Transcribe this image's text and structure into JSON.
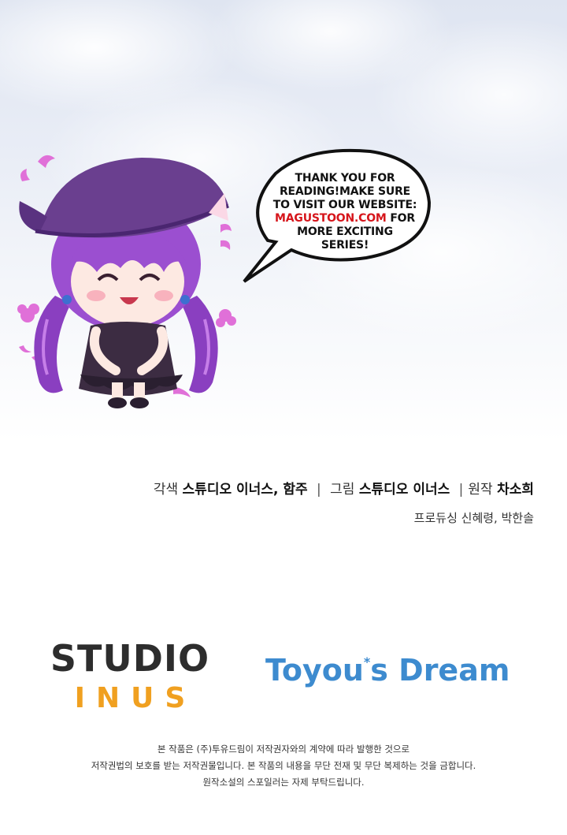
{
  "speech_bubble": {
    "line1": "THANK YOU FOR",
    "line2": "READING!MAKE SURE",
    "line3": "TO VISIT OUR WEBSITE:",
    "line4_link": "MAGUSTOON.COM",
    "line4_rest": " FOR",
    "line5": "MORE EXCITING",
    "line6": "SERIES!"
  },
  "credits": {
    "adaptation_label": "각색",
    "adaptation_value": "스튜디오 이너스, 함주",
    "art_label": "그림",
    "art_value": "스튜디오 이너스",
    "original_label": "원작",
    "original_value": "차소희",
    "separator": "|",
    "producing_label": "프로듀싱",
    "producing_value": "신혜령, 박한솔"
  },
  "logos": {
    "studio_line1": "STUDIO",
    "studio_line2": "INUS",
    "toyou_part1": "Toyou",
    "toyou_star": "*",
    "toyou_part2": "s Dream"
  },
  "notice": {
    "line1": "본 작품은 (주)투유드림이 저작권자와의 계약에 따라 발행한 것으로",
    "line2": "저작권법의 보호를 받는 저작권물입니다. 본 작품의 내용을 무단 전재 및 무단 복제하는 것을 금합니다.",
    "line3": "원작소설의 스포일러는 자제 부탁드립니다."
  },
  "colors": {
    "link_red": "#d6151b",
    "studio_orange": "#f0a020",
    "toyou_blue": "#3d8bcf",
    "hat_purple": "#6a3f8f"
  }
}
